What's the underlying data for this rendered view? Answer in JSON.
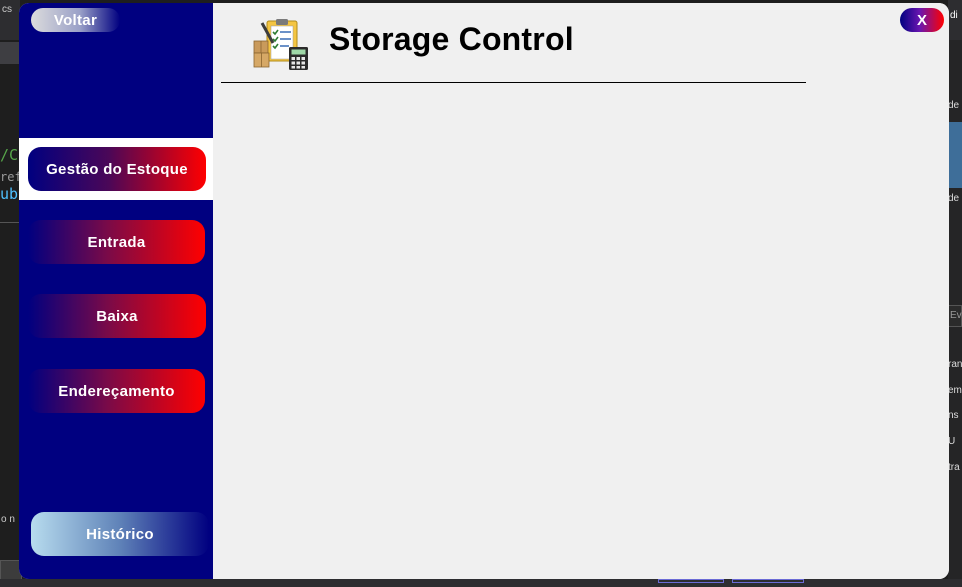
{
  "background": {
    "left_top_text": "cs",
    "left_code_lines": [
      "/C",
      "refe",
      "ub"
    ],
    "left_bottom_text": "o n",
    "right_top_text": "di",
    "right_items": [
      "de",
      "de",
      "Ev",
      "ran",
      "em",
      "ns",
      "U",
      "tra"
    ]
  },
  "window": {
    "back_label": "Voltar",
    "close_label": "X",
    "title": "Storage Control",
    "logo_icon": "inventory-clipboard-calculator-icon"
  },
  "sidebar": {
    "items": [
      {
        "label": "Gestão do Estoque",
        "selected": true
      },
      {
        "label": "Entrada",
        "selected": false
      },
      {
        "label": "Baixa",
        "selected": false
      },
      {
        "label": "Endereçamento",
        "selected": false
      }
    ],
    "history_label": "Histórico"
  },
  "colors": {
    "sidebar_bg": "#000080",
    "accent_red": "#ff0000",
    "content_bg": "#f0f0f0",
    "history_light": "#b7dcee"
  }
}
